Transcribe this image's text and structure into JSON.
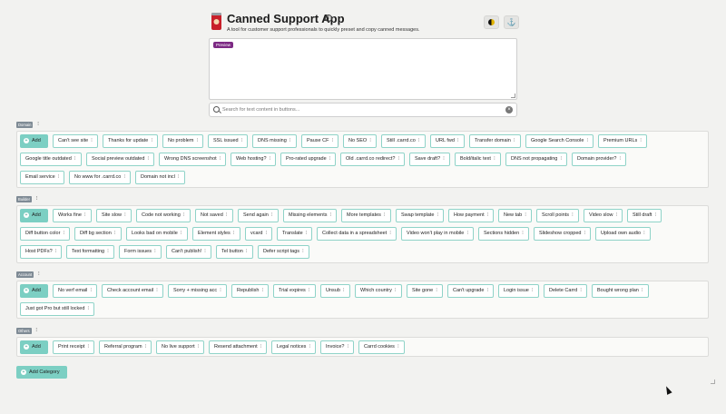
{
  "app": {
    "title": "Canned Support App",
    "subtitle": "A tool for customer support professionals to quickly preset and copy canned messages.",
    "info_icon": "info-icon",
    "theme_icon": "half-moon-icon",
    "share_icon": "share-icon",
    "logo_icon": "can-logo-icon"
  },
  "preview": {
    "badge": "Preview",
    "content": ""
  },
  "search": {
    "placeholder": "Search for text content in buttons...",
    "clear_icon": "clear-icon"
  },
  "add_label": "Add",
  "menu_glyph": "⁝",
  "categories": [
    {
      "name": "Domain",
      "buttons": [
        "Can't see site",
        "Thanks for update",
        "No problem",
        "SSL issued",
        "DNS missing",
        "Pause CF",
        "No SEO",
        "Still .carrd.co",
        "URL fwd",
        "Transfer domain",
        "Google Search Console",
        "Premium URLs",
        "Google title outdated",
        "Social preview outdated",
        "Wrong DNS screenshot",
        "Web hosting?",
        "Pro-rated upgrade",
        "Old .carrd.co redirect?",
        "Save draft?",
        "Bold/italic text",
        "DNS not propagating",
        "Domain provider?",
        "Email service",
        "No www for .carrd.co",
        "Domain not incl"
      ]
    },
    {
      "name": "Builder",
      "buttons": [
        "Works fine",
        "Site slow",
        "Code not working",
        "Not saved",
        "Send again",
        "Missing elements",
        "More templates",
        "Swap template",
        "How payment",
        "New tab",
        "Scroll points",
        "Video slow",
        "Still draft",
        "Diff button color",
        "Diff bg section",
        "Looks bad on mobile",
        "Element styles",
        "vcard",
        "Translate",
        "Collect data in a spreadsheet",
        "Video won't play in mobile",
        "Sections hidden",
        "Slideshow cropped",
        "Upload own audio",
        "Host PDFs?",
        "Text formatting",
        "Form issues",
        "Can't publish!",
        "Tel button",
        "Defer script tags"
      ]
    },
    {
      "name": "Account",
      "buttons": [
        "No verf email",
        "Check account email",
        "Sorry + missing acc",
        "Republish",
        "Trial expires",
        "Unsub",
        "Which country",
        "Site gone",
        "Can't upgrade",
        "Login issue",
        "Delete Carrd",
        "Bought wrong plan",
        "Just got Pro but still locked"
      ]
    },
    {
      "name": "Others",
      "buttons": [
        "Print receipt",
        "Referral program",
        "No live support",
        "Resend attachment",
        "Legal notices",
        "Invoice?",
        "Carrd cookies"
      ]
    }
  ],
  "add_category_label": "Add Category",
  "colors": {
    "accent": "#7ccfc3",
    "button_border": "#8fd3c8",
    "badge": "#7d2a84",
    "category_label": "#7f8b95"
  }
}
